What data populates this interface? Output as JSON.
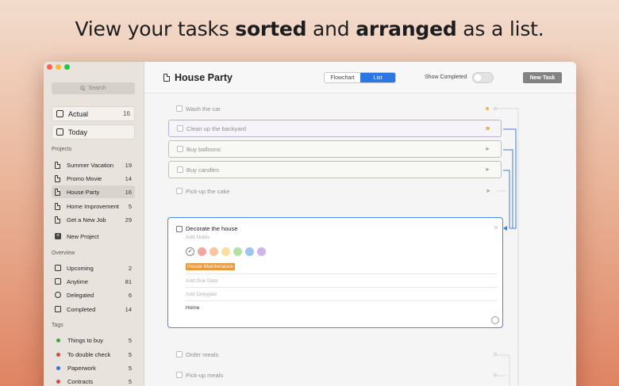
{
  "headline": {
    "prefix": "View your tasks ",
    "bold1": "sorted",
    "mid": " and ",
    "bold2": "arranged",
    "suffix": " as a list."
  },
  "sidebar": {
    "search_placeholder": "Search",
    "actual": {
      "label": "Actual",
      "count": "16"
    },
    "today": {
      "label": "Today"
    },
    "projects_label": "Projects",
    "projects": [
      {
        "label": "Summer Vacation",
        "count": "19"
      },
      {
        "label": "Promo Movie",
        "count": "14"
      },
      {
        "label": "House Party",
        "count": "16"
      },
      {
        "label": "Home Improvement",
        "count": "5"
      },
      {
        "label": "Get a New Job",
        "count": "29"
      }
    ],
    "new_project": "New Project",
    "overview_label": "Overview",
    "overview": [
      {
        "label": "Upcoming",
        "count": "2"
      },
      {
        "label": "Anytime",
        "count": "81"
      },
      {
        "label": "Delegated",
        "count": "6"
      },
      {
        "label": "Completed",
        "count": "14"
      }
    ],
    "tags_label": "Tags",
    "tags": [
      {
        "label": "Things to buy",
        "count": "5",
        "color": "#3fa63a"
      },
      {
        "label": "To double check",
        "count": "5",
        "color": "#e0443a"
      },
      {
        "label": "Paperwork",
        "count": "5",
        "color": "#3a6fe0"
      },
      {
        "label": "Contracts",
        "count": "5",
        "color": "#e0443a"
      }
    ]
  },
  "toolbar": {
    "title": "House Party",
    "view_flowchart": "Flowchart",
    "view_list": "List",
    "show_completed": "Show Completed",
    "new_task": "New Task"
  },
  "tasks": [
    {
      "label": "Wash the car"
    },
    {
      "label": "Clean up the backyard"
    },
    {
      "label": "Buy balloons"
    },
    {
      "label": "Buy candles"
    },
    {
      "label": "Pick-up the cake"
    }
  ],
  "editor": {
    "title": "Decorate the house",
    "notes_placeholder": "Add Notes",
    "colors": [
      "#f2a6a0",
      "#f8c79e",
      "#f7e0a0",
      "#b4e0a6",
      "#9fc4f2",
      "#cfb4ec"
    ],
    "tag": "House Maintenance",
    "due_placeholder": "Add Due Date",
    "delegate_placeholder": "Add Delegate",
    "area": "Home"
  },
  "tasks_after": [
    {
      "label": "Order meals"
    },
    {
      "label": "Pick-up meals"
    }
  ],
  "accent": "#2d77e4"
}
